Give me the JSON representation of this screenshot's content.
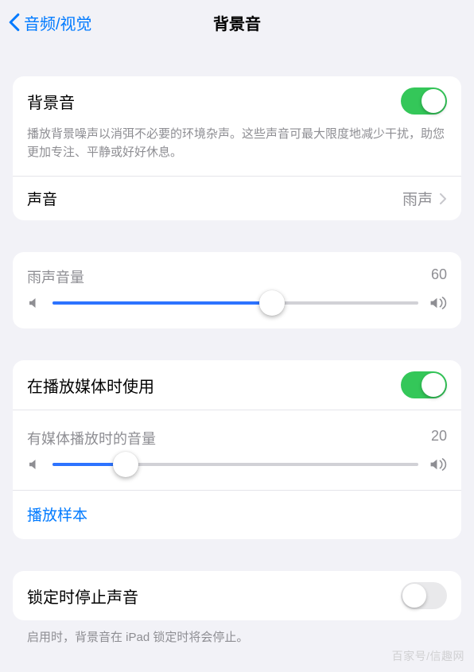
{
  "nav": {
    "back_label": "音频/视觉",
    "title": "背景音"
  },
  "main_toggle": {
    "label": "背景音",
    "on": true,
    "description": "播放背景噪声以消弭不必要的环境杂声。这些声音可最大限度地减少干扰，助您更加专注、平静或好好休息。"
  },
  "sound_row": {
    "label": "声音",
    "value": "雨声"
  },
  "volume1": {
    "label": "雨声音量",
    "value": 60
  },
  "media": {
    "toggle_label": "在播放媒体时使用",
    "toggle_on": true,
    "volume_label": "有媒体播放时的音量",
    "volume_value": 20,
    "sample_label": "播放样本"
  },
  "lock": {
    "label": "锁定时停止声音",
    "on": false,
    "description": "启用时，背景音在 iPad 锁定时将会停止。"
  },
  "watermark": "百家号/信趣网"
}
